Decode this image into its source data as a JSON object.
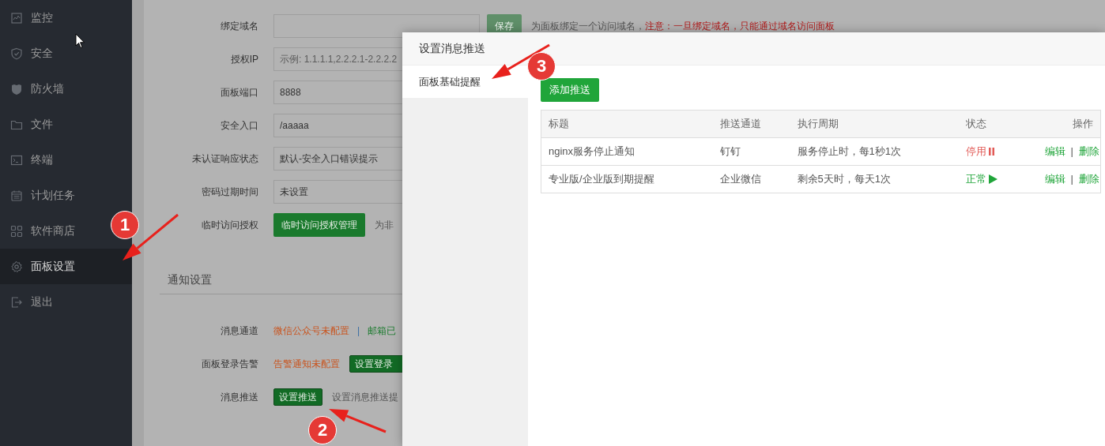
{
  "sidebar": {
    "items": [
      {
        "label": "监控",
        "kind": "monitor",
        "selected": false
      },
      {
        "label": "安全",
        "kind": "shield",
        "selected": false
      },
      {
        "label": "防火墙",
        "kind": "firewall",
        "selected": false
      },
      {
        "label": "文件",
        "kind": "folder",
        "selected": false
      },
      {
        "label": "终端",
        "kind": "terminal",
        "selected": false
      },
      {
        "label": "计划任务",
        "kind": "calendar",
        "selected": false
      },
      {
        "label": "软件商店",
        "kind": "apps",
        "selected": false
      },
      {
        "label": "面板设置",
        "kind": "gear",
        "selected": true
      },
      {
        "label": "退出",
        "kind": "logout",
        "selected": false
      }
    ]
  },
  "settings_form": {
    "rows": [
      {
        "label": "绑定域名",
        "kind": "input",
        "button": {
          "label": "保存",
          "disabled": true
        },
        "hint": "为面板绑定一个访问域名，",
        "warning": "注意：一旦绑定域名，只能通过域名访问面板"
      },
      {
        "label": "授权IP",
        "kind": "input",
        "placeholder": "示例: 1.1.1.1,2.2.2.1-2.2.2.2"
      },
      {
        "label": "面板端口",
        "kind": "input",
        "value": "8888"
      },
      {
        "label": "安全入口",
        "kind": "input",
        "value": "/aaaaa"
      },
      {
        "label": "未认证响应状态",
        "kind": "input",
        "value": "默认-安全入口错误提示"
      },
      {
        "label": "密码过期时间",
        "kind": "input",
        "value": "未设置"
      },
      {
        "label": "临时访问授权",
        "kind": "button",
        "button": {
          "label": "临时访问授权管理",
          "disabled": false
        },
        "hint": "为非"
      }
    ]
  },
  "notification_settings": {
    "title": "通知设置",
    "rows": [
      {
        "label": "消息通道",
        "kind": "channels",
        "items": [
          {
            "text": "微信公众号未配置",
            "configured": false
          },
          {
            "text": "邮箱已",
            "configured": true
          }
        ],
        "separator": "|"
      },
      {
        "label": "面板登录告警",
        "kind": "alert",
        "status": {
          "text": "告警通知未配置",
          "configured": false
        },
        "button": "设置登录"
      },
      {
        "label": "消息推送",
        "kind": "push",
        "button": "设置推送",
        "hint": "设置消息推送提"
      }
    ]
  },
  "dialog": {
    "title": "设置消息推送",
    "nav": [
      {
        "label": "面板基础提醒",
        "selected": true
      }
    ],
    "add_button": "添加推送",
    "table": {
      "columns": [
        "标题",
        "推送通道",
        "执行周期",
        "状态",
        "操作"
      ],
      "rows": [
        {
          "title": "nginx服务停止通知",
          "channel": "钉钉",
          "period": "服务停止时，每1秒1次",
          "status": {
            "text": "停用",
            "enabled": false
          },
          "actions": [
            "编辑",
            "删除"
          ],
          "separator": "|"
        },
        {
          "title": "专业版/企业版到期提醒",
          "channel": "企业微信",
          "period": "剩余5天时，每天1次",
          "status": {
            "text": "正常",
            "enabled": true
          },
          "actions": [
            "编辑",
            "删除"
          ],
          "separator": "|"
        }
      ]
    }
  },
  "annotations": [
    {
      "number": "1"
    },
    {
      "number": "2"
    },
    {
      "number": "3"
    }
  ]
}
